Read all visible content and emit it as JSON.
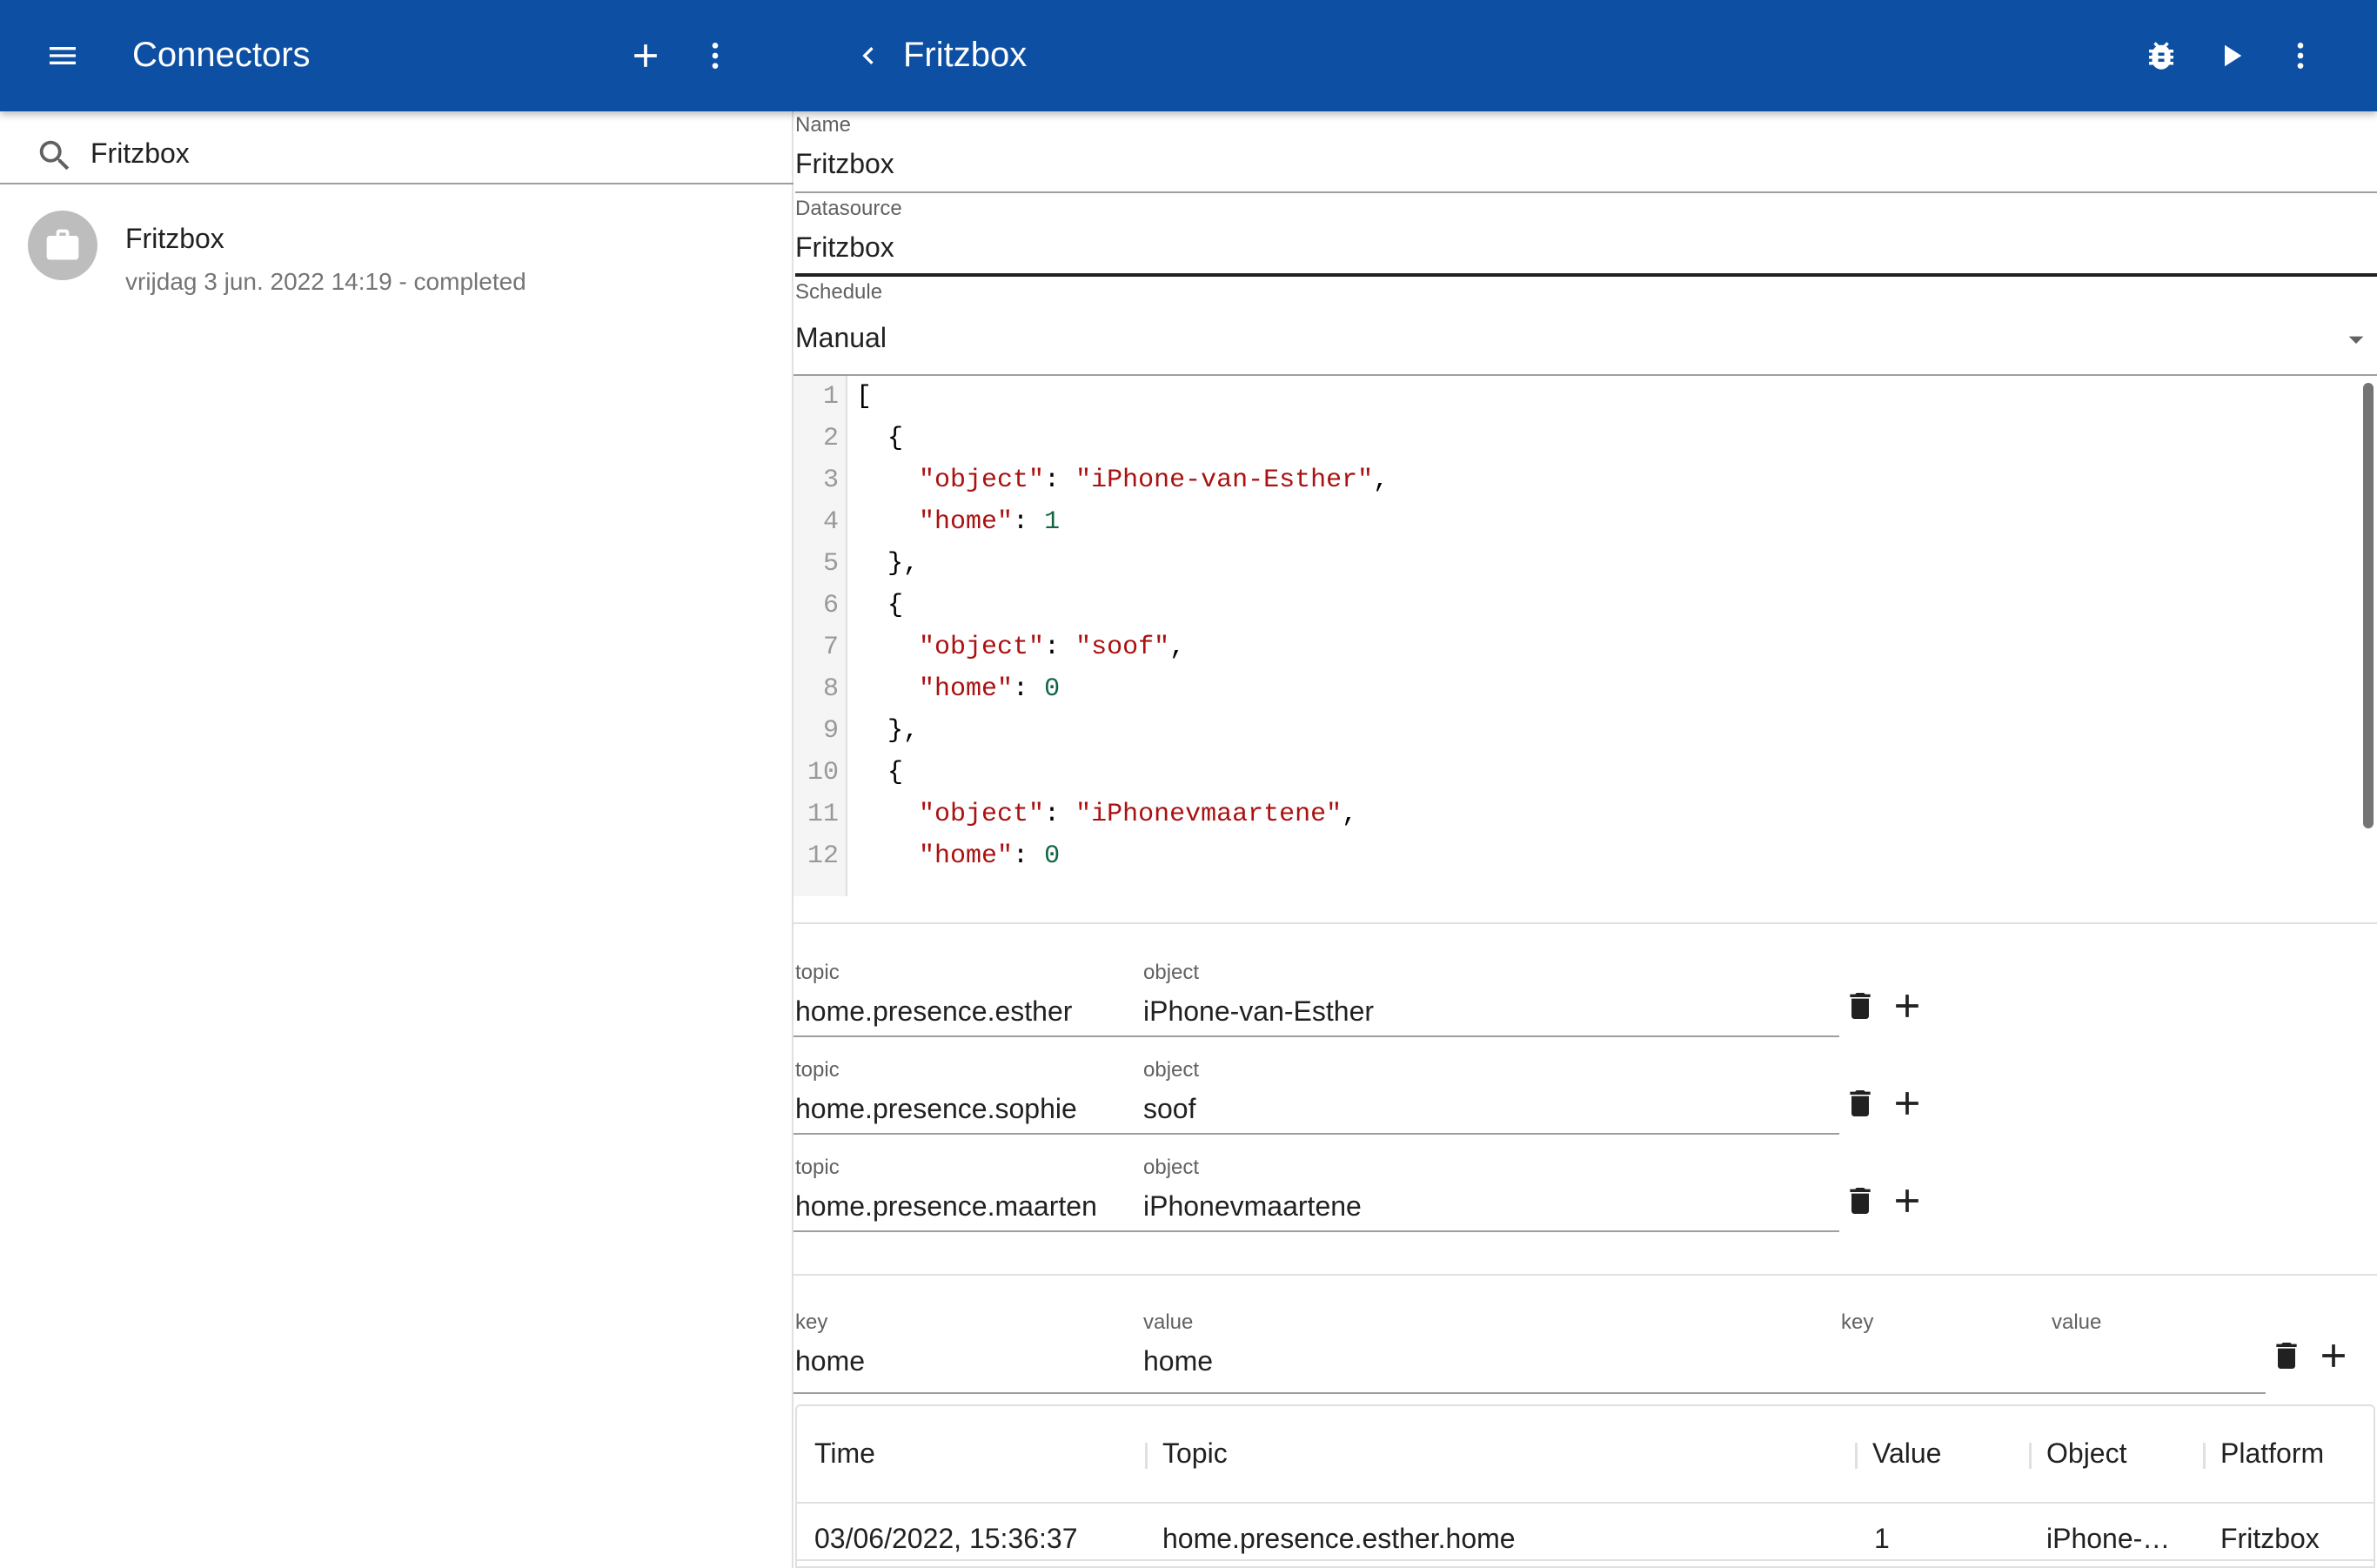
{
  "appbar": {
    "left_title": "Connectors",
    "right_title": "Fritzbox"
  },
  "sidebar": {
    "search_value": "Fritzbox",
    "items": [
      {
        "name": "Fritzbox",
        "subtitle": "vrijdag 3 jun. 2022 14:19 - completed"
      }
    ]
  },
  "form": {
    "name": {
      "label": "Name",
      "value": "Fritzbox"
    },
    "datasource": {
      "label": "Datasource",
      "value": "Fritzbox"
    },
    "schedule": {
      "label": "Schedule",
      "value": "Manual"
    }
  },
  "editor": {
    "line_numbers": [
      "1",
      "2",
      "3",
      "4",
      "5",
      "6",
      "7",
      "8",
      "9",
      "10",
      "11",
      "12"
    ],
    "lines": [
      {
        "text": "["
      },
      {
        "text": "  {"
      },
      {
        "indent": "    ",
        "key": "\"object\"",
        "sep": ": ",
        "str": "\"iPhone-van-Esther\"",
        "tail": ","
      },
      {
        "indent": "    ",
        "key": "\"home\"",
        "sep": ": ",
        "num": "1"
      },
      {
        "text": "  },"
      },
      {
        "text": "  {"
      },
      {
        "indent": "    ",
        "key": "\"object\"",
        "sep": ": ",
        "str": "\"soof\"",
        "tail": ","
      },
      {
        "indent": "    ",
        "key": "\"home\"",
        "sep": ": ",
        "num": "0"
      },
      {
        "text": "  },"
      },
      {
        "text": "  {"
      },
      {
        "indent": "    ",
        "key": "\"object\"",
        "sep": ": ",
        "str": "\"iPhonevmaartene\"",
        "tail": ","
      },
      {
        "indent": "    ",
        "key": "\"home\"",
        "sep": ": ",
        "num": "0"
      }
    ]
  },
  "mappings": [
    {
      "topic_label": "topic",
      "topic": "home.presence.esther",
      "object_label": "object",
      "object": "iPhone-van-Esther"
    },
    {
      "topic_label": "topic",
      "topic": "home.presence.sophie",
      "object_label": "object",
      "object": "soof"
    },
    {
      "topic_label": "topic",
      "topic": "home.presence.maarten",
      "object_label": "object",
      "object": "iPhonevmaartene"
    }
  ],
  "keyvalue": {
    "key_label": "key",
    "key": "home",
    "value_label": "value",
    "value": "home",
    "key2_label": "key",
    "value2_label": "value"
  },
  "table": {
    "headers": [
      "Time",
      "Topic",
      "Value",
      "Object",
      "Platform"
    ],
    "rows": [
      [
        "03/06/2022, 15:36:37",
        "home.presence.esther.home",
        "1",
        "iPhone-…",
        "Fritzbox"
      ]
    ]
  },
  "icons": {
    "menu": "menu-icon",
    "add": "plus-icon",
    "more": "more-vert-icon",
    "back": "chevron-left-icon",
    "debug": "bug-icon",
    "run": "play-icon",
    "search": "search-icon",
    "connector": "briefcase-icon",
    "dropdown": "arrow-drop-down-icon",
    "delete": "trash-icon"
  },
  "colors": {
    "appbar": "#0d4fa3",
    "string": "#a11",
    "number": "#164"
  }
}
